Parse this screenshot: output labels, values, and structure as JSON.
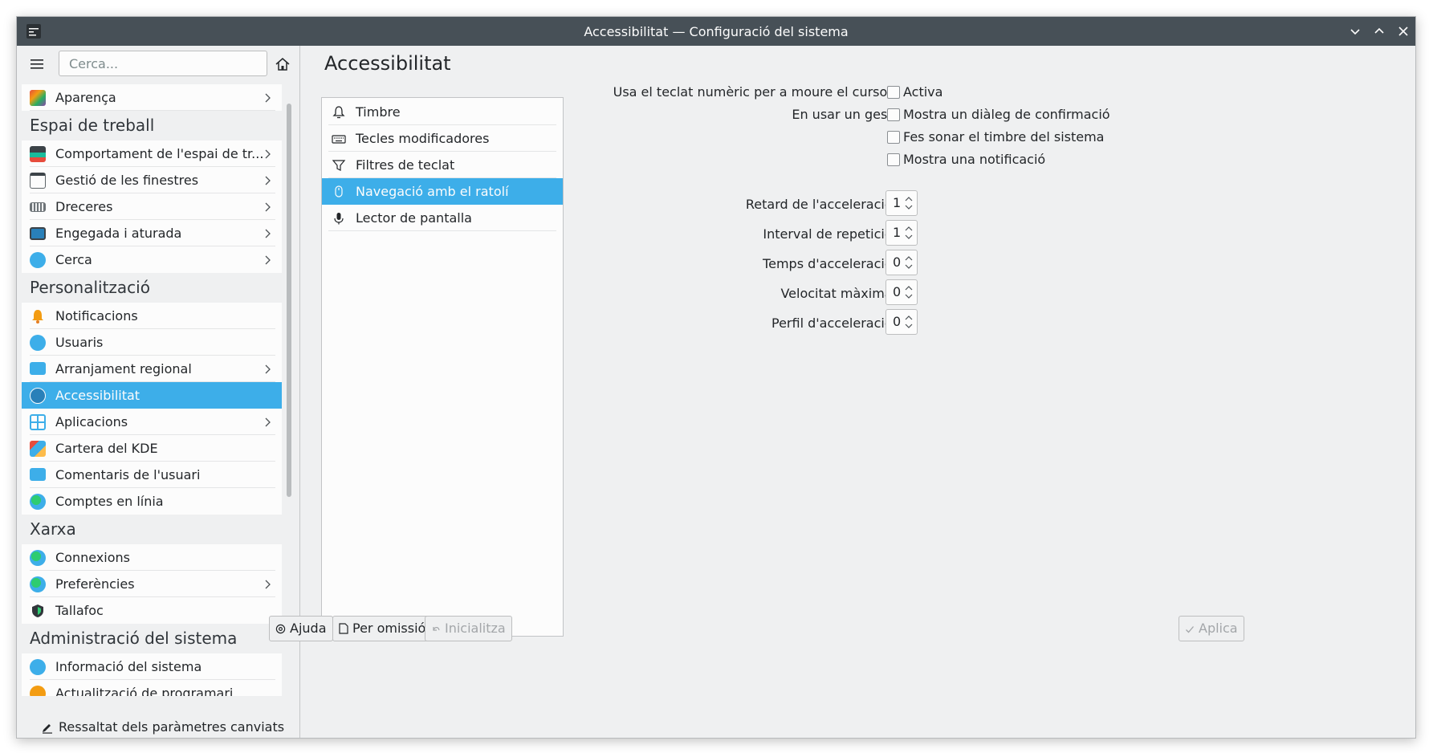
{
  "window": {
    "title": "Accessibilitat — Configuració del sistema"
  },
  "sidebar": {
    "search_placeholder": "Cerca...",
    "top_item": {
      "label": "Aparença",
      "icon": "appearance-icon"
    },
    "groups": [
      {
        "header": "Espai de treball",
        "items": [
          {
            "label": "Comportament de l'espai de tr...",
            "icon": "workspace-behavior-icon"
          },
          {
            "label": "Gestió de les finestres",
            "icon": "window-management-icon"
          },
          {
            "label": "Dreceres",
            "icon": "keyboard-shortcuts-icon"
          },
          {
            "label": "Engegada i aturada",
            "icon": "startup-shutdown-icon"
          },
          {
            "label": "Cerca",
            "icon": "search-icon"
          }
        ]
      },
      {
        "header": "Personalització",
        "items": [
          {
            "label": "Notificacions",
            "icon": "bell-icon"
          },
          {
            "label": "Usuaris",
            "icon": "users-icon"
          },
          {
            "label": "Arranjament regional",
            "icon": "regional-icon"
          },
          {
            "label": "Accessibilitat",
            "icon": "accessibility-icon"
          },
          {
            "label": "Aplicacions",
            "icon": "applications-icon"
          },
          {
            "label": "Cartera del KDE",
            "icon": "wallet-icon"
          },
          {
            "label": "Comentaris de l'usuari",
            "icon": "feedback-icon"
          },
          {
            "label": "Comptes en línia",
            "icon": "globe-icon"
          }
        ]
      },
      {
        "header": "Xarxa",
        "items": [
          {
            "label": "Connexions",
            "icon": "globe-icon"
          },
          {
            "label": "Preferències",
            "icon": "globe-icon"
          },
          {
            "label": "Tallafoc",
            "icon": "firewall-icon"
          }
        ]
      },
      {
        "header": "Administració del sistema",
        "items": [
          {
            "label": "Informació del sistema",
            "icon": "info-icon"
          },
          {
            "label": "Actualització de programari",
            "icon": "update-icon"
          }
        ]
      }
    ],
    "highlight_button": "Ressaltat dels paràmetres canviats"
  },
  "main": {
    "title": "Accessibilitat",
    "modules": [
      {
        "label": "Timbre",
        "icon": "bell-outline-icon"
      },
      {
        "label": "Tecles modificadores",
        "icon": "keyboard-icon"
      },
      {
        "label": "Filtres de teclat",
        "icon": "filter-icon"
      },
      {
        "label": "Navegació amb el ratolí",
        "icon": "mouse-icon"
      },
      {
        "label": "Lector de pantalla",
        "icon": "microphone-icon"
      }
    ],
    "form": {
      "numpad_label": "Usa el teclat numèric per a moure el cursor:",
      "numpad_checkbox": "Activa",
      "gesture_label": "En usar un gest:",
      "gesture_options": [
        "Mostra un diàleg de confirmació",
        "Fes sonar el timbre del sistema",
        "Mostra una notificació"
      ],
      "spinners": [
        {
          "label": "Retard de l'acceleració:",
          "value": "1"
        },
        {
          "label": "Interval de repetició:",
          "value": "1"
        },
        {
          "label": "Temps d'acceleració:",
          "value": "0"
        },
        {
          "label": "Velocitat màxima:",
          "value": "0"
        },
        {
          "label": "Perfil d'acceleració:",
          "value": "0"
        }
      ]
    },
    "buttons": {
      "help": "Ajuda",
      "defaults": "Per omissió",
      "reset": "Inicialitza",
      "apply": "Aplica"
    }
  },
  "colors": {
    "accent": "#3daee9",
    "titlebar": "#475057",
    "window_bg": "#eff0f1"
  }
}
